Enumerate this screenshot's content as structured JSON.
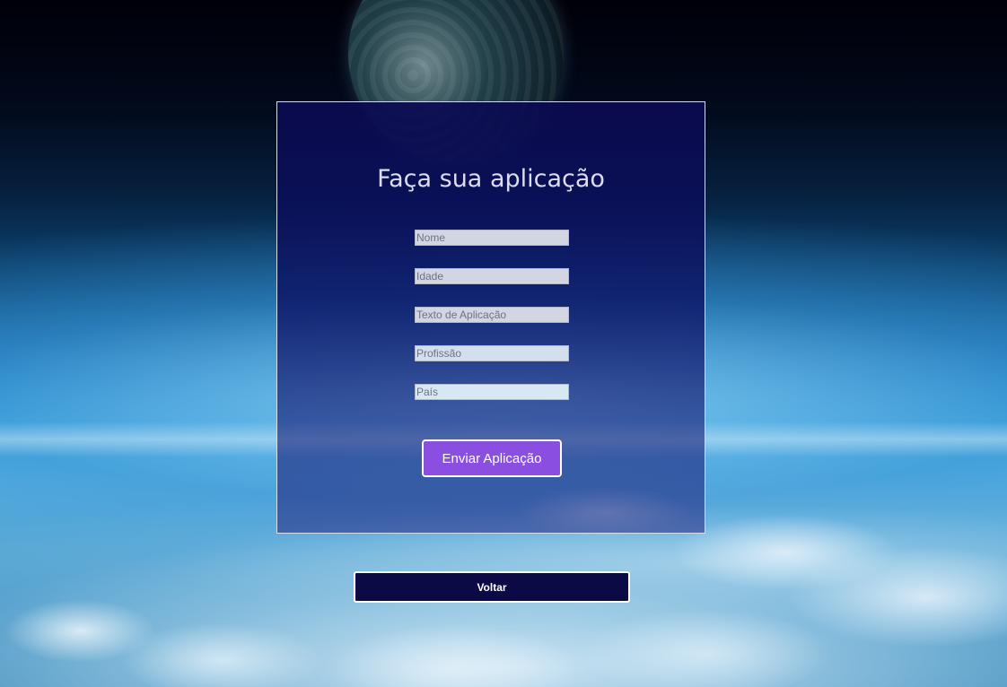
{
  "form": {
    "title": "Faça sua aplicação",
    "fields": [
      {
        "placeholder": "Nome",
        "value": ""
      },
      {
        "placeholder": "Idade",
        "value": ""
      },
      {
        "placeholder": "Texto de Aplicação",
        "value": ""
      },
      {
        "placeholder": "Profissão",
        "value": ""
      },
      {
        "placeholder": "País",
        "value": ""
      }
    ],
    "submit_label": "Enviar Aplicação"
  },
  "back_label": "Voltar",
  "colors": {
    "panel_background": "#0c0c55",
    "submit_button": "#8a4fe0",
    "back_button": "#0b0a45",
    "title_text": "#dcdcf0"
  }
}
